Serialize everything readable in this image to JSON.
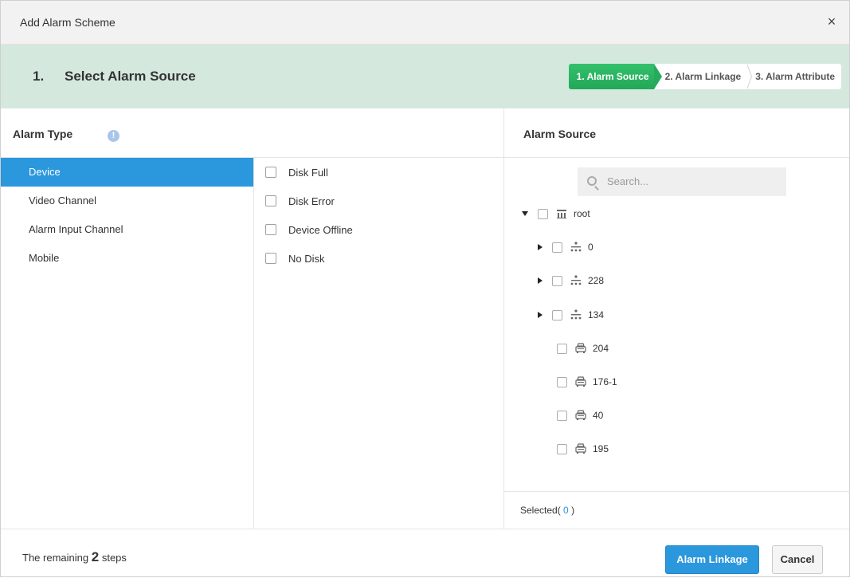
{
  "dialog": {
    "title": "Add Alarm Scheme",
    "close_symbol": "×"
  },
  "step_header": {
    "number": "1.",
    "title": "Select Alarm Source",
    "steps": [
      "1. Alarm Source",
      "2. Alarm Linkage",
      "3. Alarm Attribute"
    ],
    "active_step": 0
  },
  "alarm_type": {
    "header": "Alarm Type",
    "info_symbol": "!",
    "types": [
      "Device",
      "Video Channel",
      "Alarm Input Channel",
      "Mobile"
    ],
    "selected": "Device",
    "events": [
      "Disk Full",
      "Disk Error",
      "Device Offline",
      "No Disk"
    ]
  },
  "alarm_source": {
    "header": "Alarm Source",
    "search_placeholder": "Search...",
    "tree": [
      {
        "label": "root",
        "icon": "server-icon",
        "expanded": true,
        "level": 0
      },
      {
        "label": "0",
        "icon": "org-icon",
        "expandable": true,
        "level": 1
      },
      {
        "label": "228",
        "icon": "org-icon",
        "expandable": true,
        "level": 1
      },
      {
        "label": "134",
        "icon": "org-icon",
        "expandable": true,
        "level": 1
      },
      {
        "label": "204",
        "icon": "vehicle-icon",
        "expandable": false,
        "level": 1
      },
      {
        "label": "176-1",
        "icon": "vehicle-icon",
        "expandable": false,
        "level": 1
      },
      {
        "label": "40",
        "icon": "vehicle-icon",
        "expandable": false,
        "level": 1
      },
      {
        "label": "195",
        "icon": "vehicle-icon",
        "expandable": false,
        "level": 1
      }
    ],
    "selected_label": "Selected(",
    "selected_count": "0",
    "selected_close": ")"
  },
  "footer": {
    "remaining_prefix": "The remaining",
    "remaining_count": "2",
    "remaining_suffix": "steps",
    "next_button": "Alarm Linkage",
    "cancel_button": "Cancel"
  },
  "colors": {
    "accent": "#2b97dc",
    "step_active": "#25ab5b",
    "step_bar_bg": "#d5e8de"
  }
}
